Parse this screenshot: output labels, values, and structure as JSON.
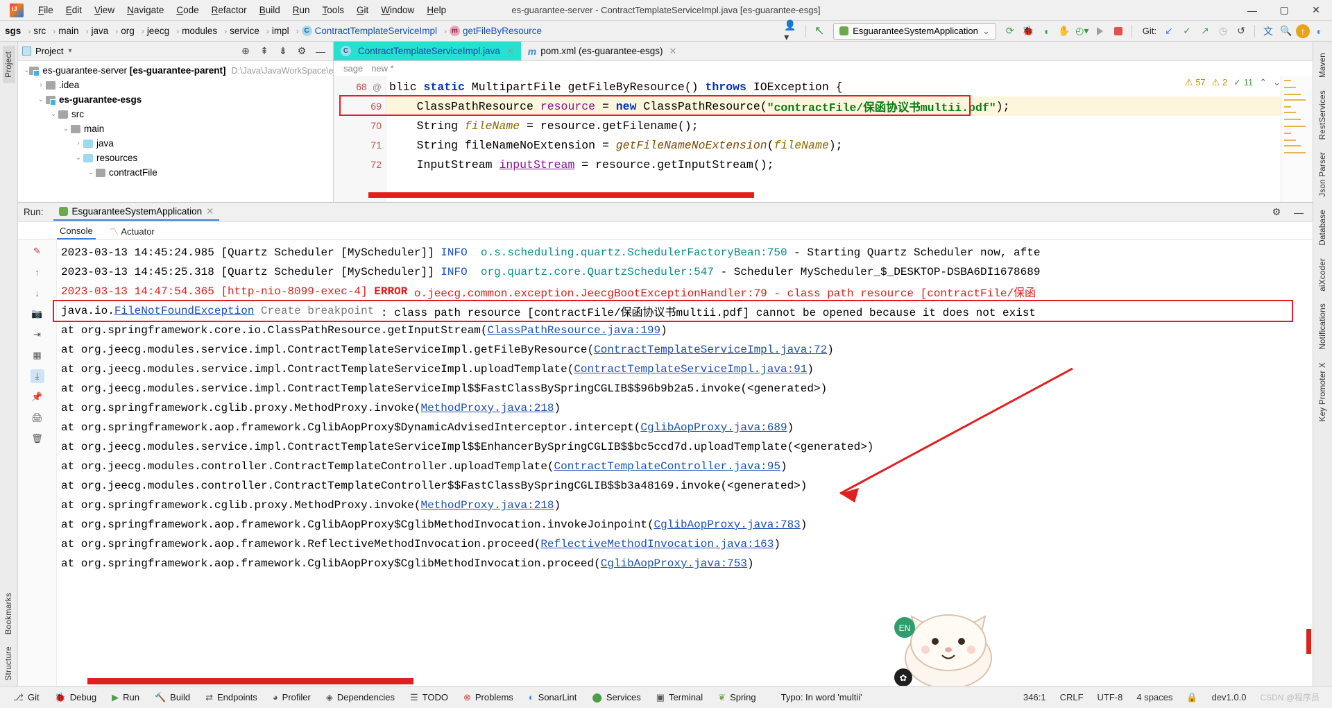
{
  "window": {
    "title": "es-guarantee-server - ContractTemplateServiceImpl.java [es-guarantee-esgs]",
    "minimize": "—",
    "maximize": "▢",
    "close": "✕"
  },
  "menu": [
    "File",
    "Edit",
    "View",
    "Navigate",
    "Code",
    "Refactor",
    "Build",
    "Run",
    "Tools",
    "Git",
    "Window",
    "Help"
  ],
  "breadcrumb": {
    "items": [
      "sgs",
      "src",
      "main",
      "java",
      "org",
      "jeecg",
      "modules",
      "service",
      "impl"
    ],
    "class_name": "ContractTemplateServiceImpl",
    "method_name": "getFileByResource",
    "class_icon": "C",
    "method_icon": "m"
  },
  "toolbar": {
    "run_config": "EsguaranteeSystemApplication",
    "chevron": "⌄",
    "git_label": "Git:",
    "icons": [
      "rerun-icon",
      "debug-icon",
      "run-with-coverage-icon",
      "profiler-icon",
      "run-dashboard-icon",
      "run-icon",
      "stop-icon"
    ],
    "git_icons": [
      "update-project-icon",
      "commit-icon",
      "push-icon",
      "history-icon",
      "rollback-icon"
    ],
    "right_icons": [
      "translate-icon",
      "search-everywhere-icon",
      "updates-icon",
      "ide-theme-icon"
    ]
  },
  "project_panel": {
    "title": "Project",
    "dropdown": "▾",
    "header_icons": [
      "locate-icon",
      "expand-all-icon",
      "collapse-all-icon",
      "settings-icon",
      "hide-icon"
    ],
    "tree": [
      {
        "depth": 0,
        "arrow": "⌄",
        "label": "es-guarantee-server",
        "bold_suffix": "[es-guarantee-parent]",
        "path": "D:\\Java\\JavaWorkSpace\\es",
        "folder": "module"
      },
      {
        "depth": 1,
        "arrow": "›",
        "label": ".idea",
        "folder": "grey"
      },
      {
        "depth": 1,
        "arrow": "⌄",
        "label": "es-guarantee-esgs",
        "bold": true,
        "folder": "module"
      },
      {
        "depth": 2,
        "arrow": "⌄",
        "label": "src",
        "folder": "grey"
      },
      {
        "depth": 3,
        "arrow": "⌄",
        "label": "main",
        "folder": "grey"
      },
      {
        "depth": 4,
        "arrow": "›",
        "label": "java",
        "folder": "blue"
      },
      {
        "depth": 4,
        "arrow": "⌄",
        "label": "resources",
        "folder": "blue"
      },
      {
        "depth": 5,
        "arrow": "⌄",
        "label": "contractFile",
        "folder": "grey"
      }
    ]
  },
  "editor": {
    "tabs": [
      {
        "label": "ContractTemplateServiceImpl.java",
        "icon": "C",
        "active": true,
        "close": "✕"
      },
      {
        "label": "pom.xml (es-guarantee-esgs)",
        "icon": "m",
        "active": false,
        "close": "✕"
      }
    ],
    "breadcrumb_line": [
      "sage",
      "new *"
    ],
    "inspections": {
      "warnings": "57",
      "weak_warnings": "2",
      "typos": "11",
      "warn_icon": "⚠",
      "weak_icon": "⚠",
      "typo_icon": "✓"
    },
    "lines": [
      {
        "num": "68",
        "gutter_mark": "@",
        "fold": "⊟",
        "tokens": [
          {
            "t": "blic ",
            "c": ""
          },
          {
            "t": "static ",
            "c": "k"
          },
          {
            "t": "MultipartFile ",
            "c": ""
          },
          {
            "t": "getFileByResource",
            "c": ""
          },
          {
            "t": "() ",
            "c": ""
          },
          {
            "t": "throws ",
            "c": "k"
          },
          {
            "t": "IOException {",
            "c": ""
          }
        ]
      },
      {
        "num": "69",
        "highlight": true,
        "tokens": [
          {
            "t": "    ClassPathResource ",
            "c": ""
          },
          {
            "t": "resource",
            "c": "fld"
          },
          {
            "t": " = ",
            "c": ""
          },
          {
            "t": "new ",
            "c": "k"
          },
          {
            "t": "ClassPathResource(",
            "c": ""
          },
          {
            "t": "\"contractFile/保函协议书multii.pdf\"",
            "c": "s"
          },
          {
            "t": ");",
            "c": ""
          }
        ]
      },
      {
        "num": "70",
        "tokens": [
          {
            "t": "    String ",
            "c": ""
          },
          {
            "t": "fileName",
            "c": "st"
          },
          {
            "t": " = resource.",
            "c": ""
          },
          {
            "t": "getFilename",
            "c": ""
          },
          {
            "t": "();",
            "c": ""
          }
        ]
      },
      {
        "num": "71",
        "tokens": [
          {
            "t": "    String ",
            "c": ""
          },
          {
            "t": "fileNameNoExtension",
            "c": ""
          },
          {
            "t": " = ",
            "c": ""
          },
          {
            "t": "getFileNameNoExtension",
            "c": "mth"
          },
          {
            "t": "(",
            "c": ""
          },
          {
            "t": "fileName",
            "c": "st"
          },
          {
            "t": ");",
            "c": ""
          }
        ]
      },
      {
        "num": "72",
        "tokens": [
          {
            "t": "    InputStream ",
            "c": ""
          },
          {
            "t": "inputStream",
            "c": "fldu"
          },
          {
            "t": " = resource.",
            "c": ""
          },
          {
            "t": "getInputStream",
            "c": ""
          },
          {
            "t": "();",
            "c": ""
          }
        ]
      }
    ]
  },
  "run_panel": {
    "label": "Run:",
    "config_name": "EsguaranteeSystemApplication",
    "close": "✕",
    "settings_icon": "⚙",
    "minimize_icon": "—",
    "tabs": [
      {
        "label": "Console",
        "active": true
      },
      {
        "label": "Actuator",
        "active": false,
        "icon": "actuator-icon"
      }
    ],
    "gutter_icons": [
      "soft-wrap-icon",
      "up-icon",
      "down-icon",
      "camera-icon",
      "print-icon",
      "scroll-end-icon",
      "settings-icon",
      "trash-icon",
      "pin-icon"
    ],
    "console": [
      {
        "type": "info",
        "segments": [
          {
            "t": "2023-03-13 14:45:24.985 [Quartz Scheduler [MyScheduler]] ",
            "c": ""
          },
          {
            "t": "INFO",
            "c": "blue"
          },
          {
            "t": "  ",
            "c": ""
          },
          {
            "t": "o.s.scheduling.quartz.SchedulerFactoryBean:750",
            "c": "teal"
          },
          {
            "t": " - Starting Quartz Scheduler now, afte",
            "c": ""
          }
        ]
      },
      {
        "type": "info",
        "segments": [
          {
            "t": "2023-03-13 14:45:25.318 [Quartz Scheduler [MyScheduler]] ",
            "c": ""
          },
          {
            "t": "INFO",
            "c": "blue"
          },
          {
            "t": "  ",
            "c": ""
          },
          {
            "t": "org.quartz.core.QuartzScheduler:547",
            "c": "teal"
          },
          {
            "t": " - Scheduler MyScheduler_$_DESKTOP-DSBA6DI1678689",
            "c": ""
          }
        ]
      },
      {
        "type": "error",
        "segments": [
          {
            "t": "2023-03-13 14:47:54.365 [http-nio-8099-exec-4] ",
            "c": ""
          },
          {
            "t": "ERROR",
            "c": "bold"
          },
          {
            "t": " o.jeecg.common.exception.JeecgBootExceptionHandler:79 - class path resource [contractFile/保函",
            "c": ""
          }
        ]
      },
      {
        "type": "exception",
        "segments": [
          {
            "t": "java.io.",
            "c": ""
          },
          {
            "t": "FileNotFoundException",
            "c": "lnk"
          },
          {
            "t": " Create breakpoint",
            "c": "grey"
          },
          {
            "t": " : class path resource [contractFile/保函协议书multii.pdf] cannot be opened because it does not exist",
            "c": ""
          }
        ]
      },
      {
        "type": "trace",
        "indent": 1,
        "segments": [
          {
            "t": "at org.springframework.core.io.ClassPathResource.getInputStream(",
            "c": ""
          },
          {
            "t": "ClassPathResource.java:199",
            "c": "lnk"
          },
          {
            "t": ")",
            "c": ""
          }
        ]
      },
      {
        "type": "trace",
        "indent": 1,
        "segments": [
          {
            "t": "at org.jeecg.modules.service.impl.ContractTemplateServiceImpl.getFileByResource(",
            "c": ""
          },
          {
            "t": "ContractTemplateServiceImpl.java:72",
            "c": "lnk"
          },
          {
            "t": ")",
            "c": ""
          }
        ]
      },
      {
        "type": "trace",
        "indent": 1,
        "segments": [
          {
            "t": "at org.jeecg.modules.service.impl.ContractTemplateServiceImpl.uploadTemplate(",
            "c": ""
          },
          {
            "t": "ContractTemplateServiceImpl.java:91",
            "c": "lnk"
          },
          {
            "t": ")",
            "c": ""
          }
        ]
      },
      {
        "type": "trace",
        "indent": 1,
        "segments": [
          {
            "t": "at org.jeecg.modules.service.impl.ContractTemplateServiceImpl$$FastClassBySpringCGLIB$$96b9b2a5.invoke(<generated>)",
            "c": ""
          }
        ]
      },
      {
        "type": "trace",
        "indent": 1,
        "segments": [
          {
            "t": "at org.springframework.cglib.proxy.MethodProxy.invoke(",
            "c": ""
          },
          {
            "t": "MethodProxy.java:218",
            "c": "lnk"
          },
          {
            "t": ")",
            "c": ""
          }
        ]
      },
      {
        "type": "trace",
        "indent": 1,
        "segments": [
          {
            "t": "at org.springframework.aop.framework.CglibAopProxy$DynamicAdvisedInterceptor.intercept(",
            "c": ""
          },
          {
            "t": "CglibAopProxy.java:689",
            "c": "lnk"
          },
          {
            "t": ")",
            "c": ""
          }
        ]
      },
      {
        "type": "trace",
        "indent": 1,
        "segments": [
          {
            "t": "at org.jeecg.modules.service.impl.ContractTemplateServiceImpl$$EnhancerBySpringCGLIB$$bc5ccd7d.uploadTemplate(<generated>)",
            "c": ""
          }
        ]
      },
      {
        "type": "trace",
        "indent": 1,
        "segments": [
          {
            "t": "at org.jeecg.modules.controller.ContractTemplateController.uploadTemplate(",
            "c": ""
          },
          {
            "t": "ContractTemplateController.java:95",
            "c": "lnk"
          },
          {
            "t": ")",
            "c": ""
          }
        ]
      },
      {
        "type": "trace",
        "indent": 1,
        "segments": [
          {
            "t": "at org.jeecg.modules.controller.ContractTemplateController$$FastClassBySpringCGLIB$$b3a48169.invoke(<generated>)",
            "c": ""
          }
        ]
      },
      {
        "type": "trace",
        "indent": 1,
        "segments": [
          {
            "t": "at org.springframework.cglib.proxy.MethodProxy.invoke(",
            "c": ""
          },
          {
            "t": "MethodProxy.java:218",
            "c": "lnk"
          },
          {
            "t": ")",
            "c": ""
          }
        ]
      },
      {
        "type": "trace",
        "indent": 1,
        "segments": [
          {
            "t": "at org.springframework.aop.framework.CglibAopProxy$CglibMethodInvocation.invokeJoinpoint(",
            "c": ""
          },
          {
            "t": "CglibAopProxy.java:783",
            "c": "lnk"
          },
          {
            "t": ")",
            "c": ""
          }
        ]
      },
      {
        "type": "trace",
        "indent": 1,
        "segments": [
          {
            "t": "at org.springframework.aop.framework.ReflectiveMethodInvocation.proceed(",
            "c": ""
          },
          {
            "t": "ReflectiveMethodInvocation.java:163",
            "c": "lnk"
          },
          {
            "t": ")",
            "c": ""
          }
        ]
      },
      {
        "type": "trace",
        "indent": 1,
        "segments": [
          {
            "t": "at org.springframework.aop.framework.CglibAopProxy$CglibMethodInvocation.proceed(",
            "c": ""
          },
          {
            "t": "CglibAopProxy.java:753",
            "c": "lnk"
          },
          {
            "t": ")",
            "c": ""
          }
        ]
      }
    ]
  },
  "left_strip": [
    "Project",
    "Bookmarks",
    "Structure"
  ],
  "right_strip": [
    "Maven",
    "RestServices",
    "Json Parser",
    "Database",
    "aiXcoder",
    "Notifications",
    "Key Promoter X"
  ],
  "statusbar": {
    "left_items": [
      {
        "label": "Git",
        "icon": "git-icon"
      },
      {
        "label": "Debug",
        "icon": "debug-icon"
      },
      {
        "label": "Run",
        "icon": "run-icon",
        "active": true
      },
      {
        "label": "Build",
        "icon": "build-icon"
      },
      {
        "label": "Endpoints",
        "icon": "endpoints-icon"
      },
      {
        "label": "Profiler",
        "icon": "profiler-icon"
      },
      {
        "label": "Dependencies",
        "icon": "dependencies-icon"
      },
      {
        "label": "TODO",
        "icon": "todo-icon"
      },
      {
        "label": "Problems",
        "icon": "problems-icon"
      },
      {
        "label": "SonarLint",
        "icon": "sonarlint-icon"
      },
      {
        "label": "Services",
        "icon": "services-icon"
      },
      {
        "label": "Terminal",
        "icon": "terminal-icon"
      },
      {
        "label": "Spring",
        "icon": "spring-icon"
      }
    ],
    "message": "Typo: In word 'multii'",
    "right_items": [
      "346:1",
      "CRLF",
      "UTF-8",
      "4 spaces",
      "dev1.0.0"
    ],
    "lock_icon": "lock-icon",
    "watermark": "CSDN @程序员"
  }
}
